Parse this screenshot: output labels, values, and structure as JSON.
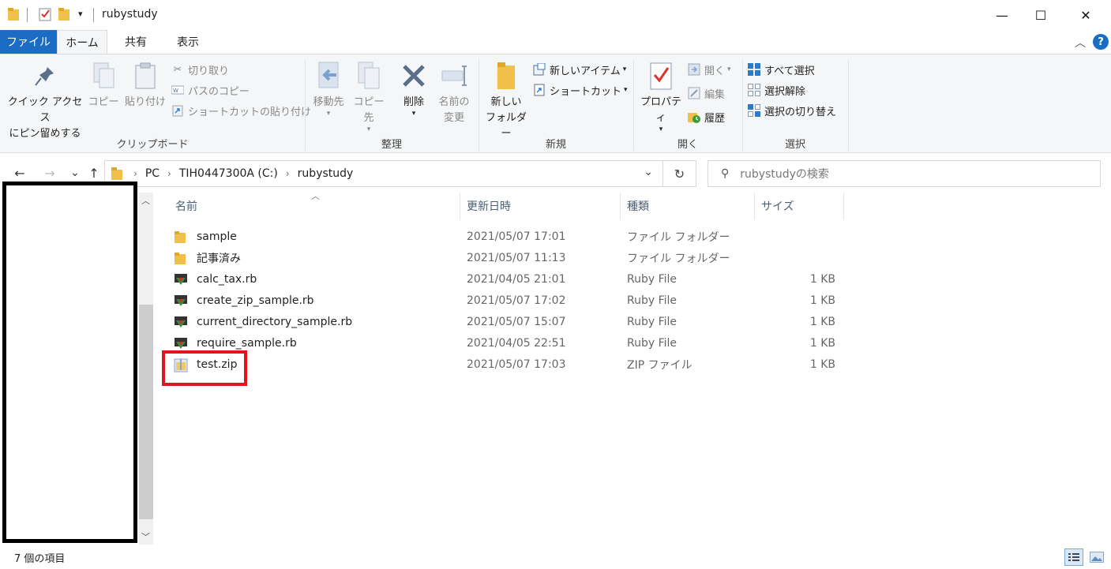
{
  "window": {
    "title": "rubystudy",
    "controls": {
      "minimize": "—",
      "maximize": "☐",
      "close": "✕"
    }
  },
  "quick_access": {
    "dropdown": "▾"
  },
  "ribbon_tabs": [
    {
      "label": "ファイル"
    },
    {
      "label": "ホーム"
    },
    {
      "label": "共有"
    },
    {
      "label": "表示"
    }
  ],
  "ribbon": {
    "clipboard": {
      "label": "クリップボード",
      "pin_line1": "クイック アクセス",
      "pin_line2": "にピン留めする",
      "copy": "コピー",
      "paste": "貼り付け",
      "cut": "切り取り",
      "copy_path": "パスのコピー",
      "paste_shortcut": "ショートカットの貼り付け"
    },
    "organize": {
      "label": "整理",
      "move_to": "移動先",
      "copy_to": "コピー先",
      "delete": "削除",
      "rename_line1": "名前の",
      "rename_line2": "変更"
    },
    "new": {
      "label": "新規",
      "new_folder_line1": "新しい",
      "new_folder_line2": "フォルダー",
      "new_item": "新しいアイテム",
      "shortcut": "ショートカット"
    },
    "open": {
      "label": "開く",
      "properties": "プロパティ",
      "open": "開く",
      "edit": "編集",
      "history": "履歴"
    },
    "select": {
      "label": "選択",
      "select_all": "すべて選択",
      "select_none": "選択解除",
      "invert": "選択の切り替え"
    }
  },
  "address_bar": {
    "back": "←",
    "forward": "→",
    "recent": "⌄",
    "up": "↑",
    "crumbs": [
      "PC",
      "TIH0447300A (C:)",
      "rubystudy"
    ],
    "dropdown": "⌄",
    "refresh": "↻",
    "search_placeholder": "rubystudyの検索"
  },
  "columns": {
    "name": "名前",
    "date": "更新日時",
    "type": "種類",
    "size": "サイズ"
  },
  "files": [
    {
      "name": "sample",
      "date": "2021/05/07 17:01",
      "type": "ファイル フォルダー",
      "size": "",
      "icon": "folder-icon"
    },
    {
      "name": "記事済み",
      "date": "2021/05/07 11:13",
      "type": "ファイル フォルダー",
      "size": "",
      "icon": "folder-icon"
    },
    {
      "name": "calc_tax.rb",
      "date": "2021/04/05 21:01",
      "type": "Ruby File",
      "size": "1 KB",
      "icon": "ruby-file-icon"
    },
    {
      "name": "create_zip_sample.rb",
      "date": "2021/05/07 17:02",
      "type": "Ruby File",
      "size": "1 KB",
      "icon": "ruby-file-icon"
    },
    {
      "name": "current_directory_sample.rb",
      "date": "2021/05/07 15:07",
      "type": "Ruby File",
      "size": "1 KB",
      "icon": "ruby-file-icon"
    },
    {
      "name": "require_sample.rb",
      "date": "2021/04/05 22:51",
      "type": "Ruby File",
      "size": "1 KB",
      "icon": "ruby-file-icon"
    },
    {
      "name": "test.zip",
      "date": "2021/05/07 17:03",
      "type": "ZIP ファイル",
      "size": "1 KB",
      "icon": "zip-file-icon"
    }
  ],
  "status": {
    "item_count": "7 個の項目"
  },
  "colors": {
    "accent": "#1a6dc2",
    "highlight": "#e4141b",
    "folder": "#f0c04a"
  }
}
